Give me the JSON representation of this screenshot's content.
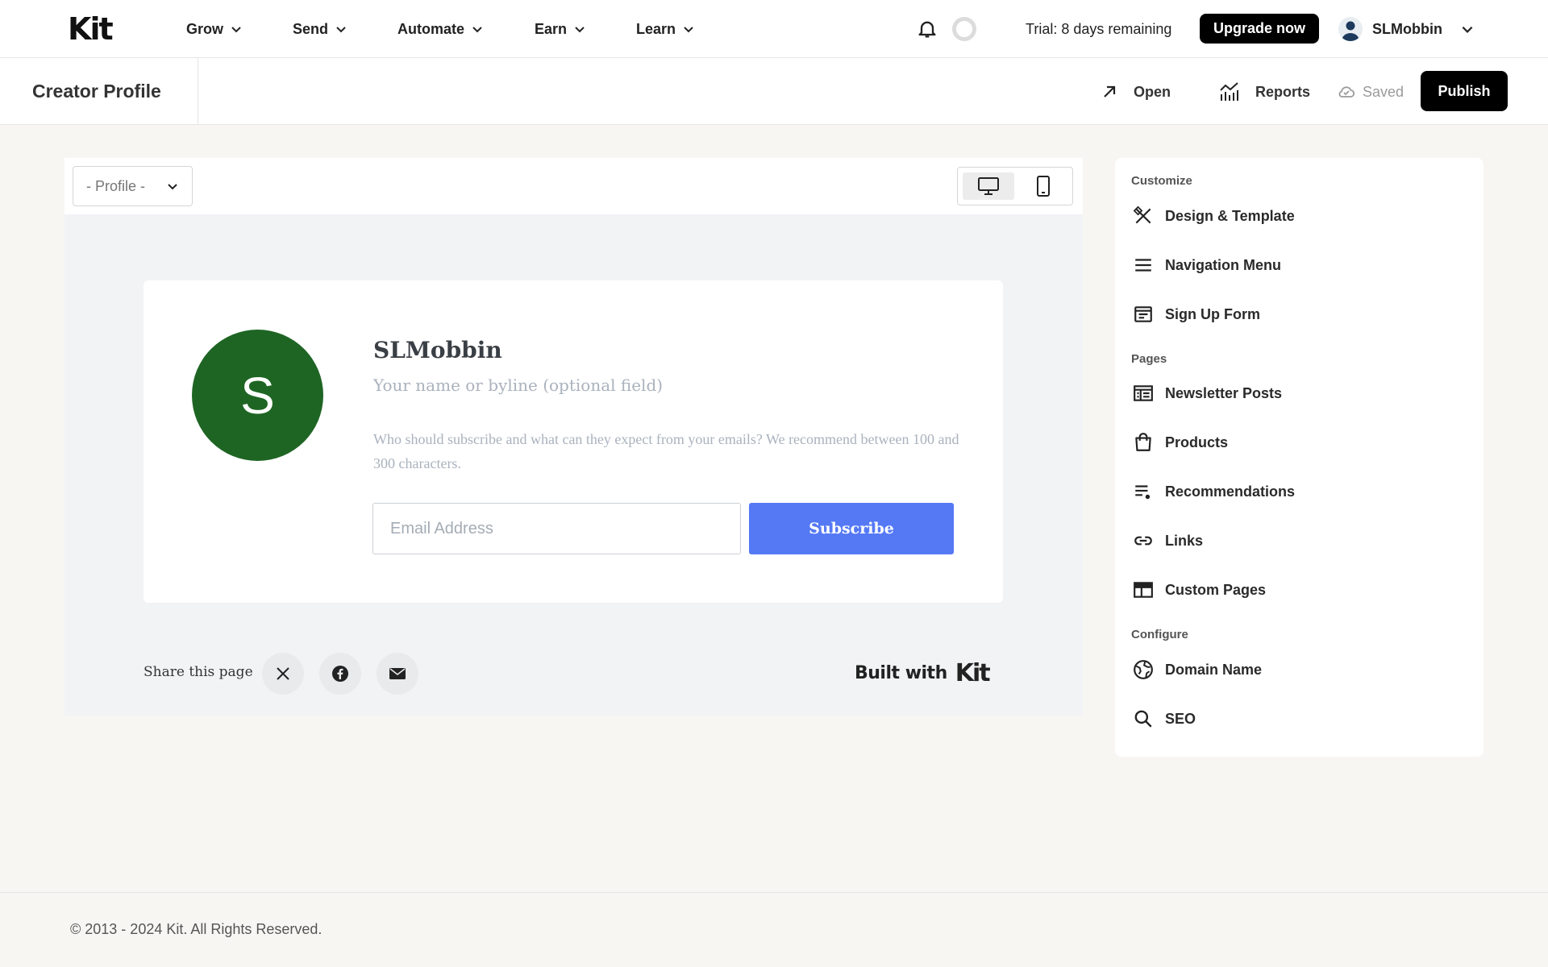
{
  "brand": {
    "logo": "Kit"
  },
  "nav": {
    "items": [
      {
        "label": "Grow"
      },
      {
        "label": "Send"
      },
      {
        "label": "Automate"
      },
      {
        "label": "Earn"
      },
      {
        "label": "Learn"
      }
    ]
  },
  "header": {
    "trial_text": "Trial: 8 days remaining",
    "upgrade_label": "Upgrade now",
    "username": "SLMobbin"
  },
  "subheader": {
    "title": "Creator Profile",
    "open_label": "Open",
    "reports_label": "Reports",
    "saved_label": "Saved",
    "publish_label": "Publish"
  },
  "editor": {
    "page_select": "- Profile -",
    "view_modes": [
      "desktop",
      "mobile"
    ],
    "active_view": "desktop"
  },
  "profile": {
    "avatar_initial": "S",
    "avatar_color": "#1e6524",
    "name": "SLMobbin",
    "byline_placeholder": "Your name or byline (optional field)",
    "description_placeholder": "Who should subscribe and what can they expect from your emails? We recommend between 100 and 300 characters.",
    "email_placeholder": "Email Address",
    "subscribe_label": "Subscribe",
    "subscribe_color": "#5579f5"
  },
  "share": {
    "label": "Share this page",
    "icons": [
      "x-icon",
      "facebook-icon",
      "email-icon"
    ],
    "built_with": "Built with",
    "built_logo": "Kit"
  },
  "panel": {
    "customize_title": "Customize",
    "customize": [
      {
        "label": "Design & Template",
        "icon": "design-icon"
      },
      {
        "label": "Navigation Menu",
        "icon": "menu-icon"
      },
      {
        "label": "Sign Up Form",
        "icon": "form-icon"
      }
    ],
    "pages_title": "Pages",
    "pages": [
      {
        "label": "Newsletter Posts",
        "icon": "newsletter-icon"
      },
      {
        "label": "Products",
        "icon": "bag-icon"
      },
      {
        "label": "Recommendations",
        "icon": "recommendations-icon"
      },
      {
        "label": "Links",
        "icon": "link-icon"
      },
      {
        "label": "Custom Pages",
        "icon": "custom-pages-icon"
      }
    ],
    "configure_title": "Configure",
    "configure": [
      {
        "label": "Domain Name",
        "icon": "globe-icon"
      },
      {
        "label": "SEO",
        "icon": "search-icon"
      }
    ]
  },
  "footer": {
    "copyright": "© 2013 - 2024 Kit. All Rights Reserved."
  }
}
